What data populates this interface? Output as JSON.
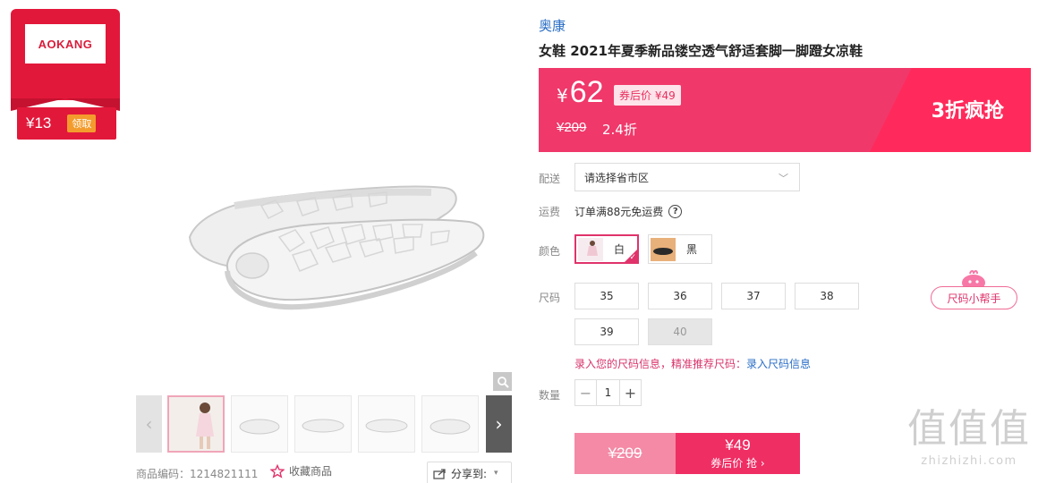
{
  "coupon": {
    "brand_logo_text": "AOKANG",
    "amount": "¥13",
    "claim_label": "领取"
  },
  "product": {
    "brand": "奥康",
    "title": "女鞋 2021年夏季新品镂空透气舒适套脚一脚蹬女凉鞋",
    "price_currency": "¥",
    "price": "62",
    "coupon_price_tag": "券后价 ¥49",
    "original_price": "¥209",
    "discount": "2.4折",
    "promo_label": "3折疯抢",
    "sku_code": "商品编码：1214821111",
    "favorite_label": "收藏商品",
    "share_label": "分享到:"
  },
  "delivery": {
    "label": "配送",
    "placeholder": "请选择省市区"
  },
  "shipping": {
    "label": "运费",
    "note": "订单满88元免运费"
  },
  "colors": {
    "label": "颜色",
    "options": [
      {
        "name": "白",
        "selected": true
      },
      {
        "name": "黑",
        "selected": false
      }
    ]
  },
  "sizes": {
    "label": "尺码",
    "options": [
      "35",
      "36",
      "37",
      "38",
      "39",
      "40"
    ],
    "disabled": [
      "40"
    ],
    "helper_label": "尺码小帮手",
    "link_record": "录入您的尺码信息，精准推荐尺码：",
    "link_enter": "录入尺码信息"
  },
  "quantity": {
    "label": "数量",
    "value": "1",
    "minus": "−",
    "plus": "+"
  },
  "buy": {
    "original_price": "¥209",
    "coupon_price": "¥49",
    "cta": "券后价 抢 ›"
  },
  "watermark": {
    "big": "值值值",
    "small": "zhizhizhi.com"
  },
  "colors_theme": {
    "accent": "#ef2e64",
    "banner": "#f0386a",
    "link": "#2a6ec6"
  }
}
